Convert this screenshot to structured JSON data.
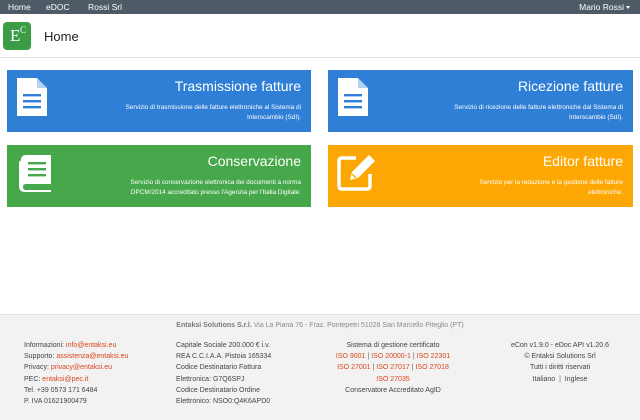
{
  "navbar": {
    "items": [
      "Home",
      "eDOC",
      "Rossi Srl"
    ],
    "user": "Mario Rossi"
  },
  "header": {
    "logo_letter": "E",
    "logo_sup": "C",
    "title": "Home"
  },
  "tiles": [
    {
      "title": "Trasmissione fatture",
      "desc_lines": [
        "Servizio di trasmissione delle fatture elettroniche al Sistema di",
        "Interscambio (SdI)."
      ],
      "icon": "document-icon",
      "color": "#2f7fd6"
    },
    {
      "title": "Ricezione fatture",
      "desc_lines": [
        "Servizio di ricezione delle fatture elettroniche dal Sistema di",
        "Interscambio (SdI)."
      ],
      "icon": "document-icon",
      "color": "#2f7fd6"
    },
    {
      "title": "Conservazione",
      "desc_lines": [
        "Servizio di conservazione elettronica dei documenti a norma",
        "DPCM/2014 accreditato presso l'Agenzia per l'Italia Digitale."
      ],
      "icon": "book-icon",
      "color": "#46a84a"
    },
    {
      "title": "Editor fatture",
      "desc_lines": [
        "Servizio per la redazione e la gestione delle fatture",
        "elettroniche."
      ],
      "icon": "edit-icon",
      "color": "#fda705"
    }
  ],
  "footer": {
    "company_name": "Entaksi Solutions S.r.l.",
    "company_address": "Via La Piana 76 - Fraz. Pontepetri 51028 San Marcello Piteglio (PT)",
    "contacts": {
      "info_label": "Informazioni:",
      "info_email": "info@entaksi.eu",
      "support_label": "Supporto:",
      "support_email": "assistenza@entaksi.eu",
      "privacy_label": "Privacy:",
      "privacy_email": "privacy@entaksi.eu",
      "pec_label": "PEC:",
      "pec_email": "entaksi@pec.it",
      "tel": "Tel. +39 0573 171 6484",
      "piva": "P. IVA 01621900479"
    },
    "legal": [
      "Capitale Sociale 200.000 € i.v.",
      "REA C.C.I.A.A. Pistoia 165334",
      "Codice Destinatario Fattura",
      "Elettronica: G7Q6SPJ",
      "Codice Destinatario Ordine",
      "Elettronico: NSO0:Q4K6APD0"
    ],
    "certs": {
      "heading": "Sistema di gestione certificato",
      "row1": [
        "ISO 9001",
        "ISO 20000-1",
        "ISO 22301"
      ],
      "row2": [
        "ISO 27001",
        "ISO 27017",
        "ISO 27018"
      ],
      "row3": [
        "ISO 27035"
      ],
      "separator": "|",
      "accredited": "Conservatore Accreditato AgID"
    },
    "version": {
      "line1": "eCon v1.9.0 - eDoc API v1.20.6",
      "line2": "© Entaksi Solutions Srl",
      "line3": "Tutti i diritti riservati",
      "lang_it": "Italiano",
      "lang_sep": "|",
      "lang_en": "Inglese"
    }
  }
}
